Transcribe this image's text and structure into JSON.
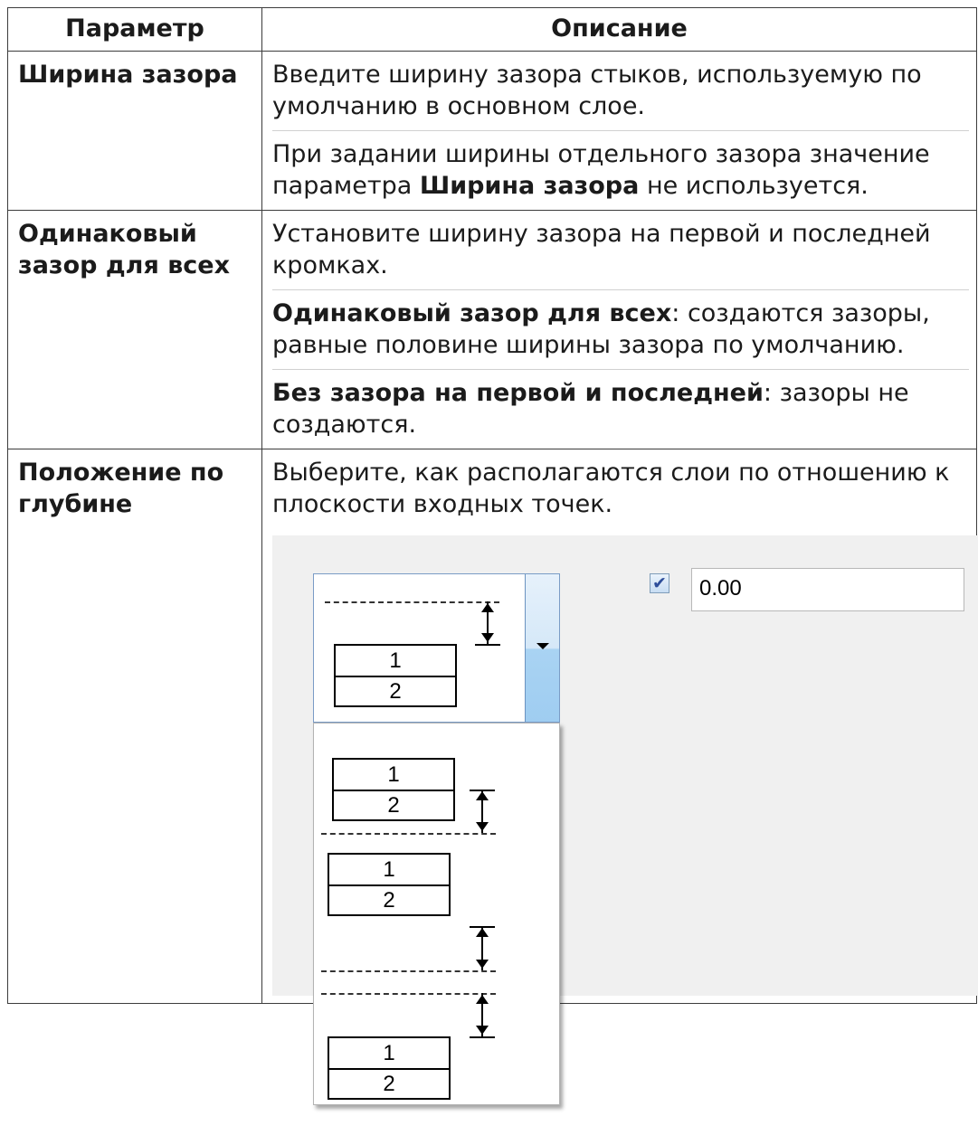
{
  "table": {
    "headers": {
      "param": "Параметр",
      "desc": "Описание"
    },
    "rows": [
      {
        "name": "Ширина зазора",
        "paras": [
          "Введите ширину зазора стыков, используемую по умолчанию в основном слое.",
          {
            "pre": "При задании ширины отдельного зазора значение параметра ",
            "bold": "Ширина зазора",
            "post": " не используется."
          }
        ]
      },
      {
        "name": "Одинаковый зазор для всех",
        "paras": [
          "Установите ширину зазора на первой и последней кромках.",
          {
            "bold": "Одинаковый зазор для всех",
            "post": ": создаются зазоры, равные половине ширины зазора по умолчанию."
          },
          {
            "bold": "Без зазора на первой и последней",
            "post": ": зазоры не создаются."
          }
        ]
      },
      {
        "name": "Положение по глубине",
        "paras": [
          "Выберите, как располагаются слои по отношению к плоскости входных точек."
        ],
        "figure": {
          "layer_labels": [
            "1",
            "2"
          ],
          "checkbox_checked": true,
          "checkbox_mark": "✔",
          "offset_value": "0.00"
        }
      }
    ]
  },
  "colors": {
    "border": "#3c3c3c",
    "figure_bg": "#f0f0f0",
    "combo_border": "#7a9cc6",
    "combo_button": "#9fcdf1"
  },
  "icons": {
    "combo_arrow": "chevron-down-icon",
    "checkbox": "checkbox-icon"
  }
}
